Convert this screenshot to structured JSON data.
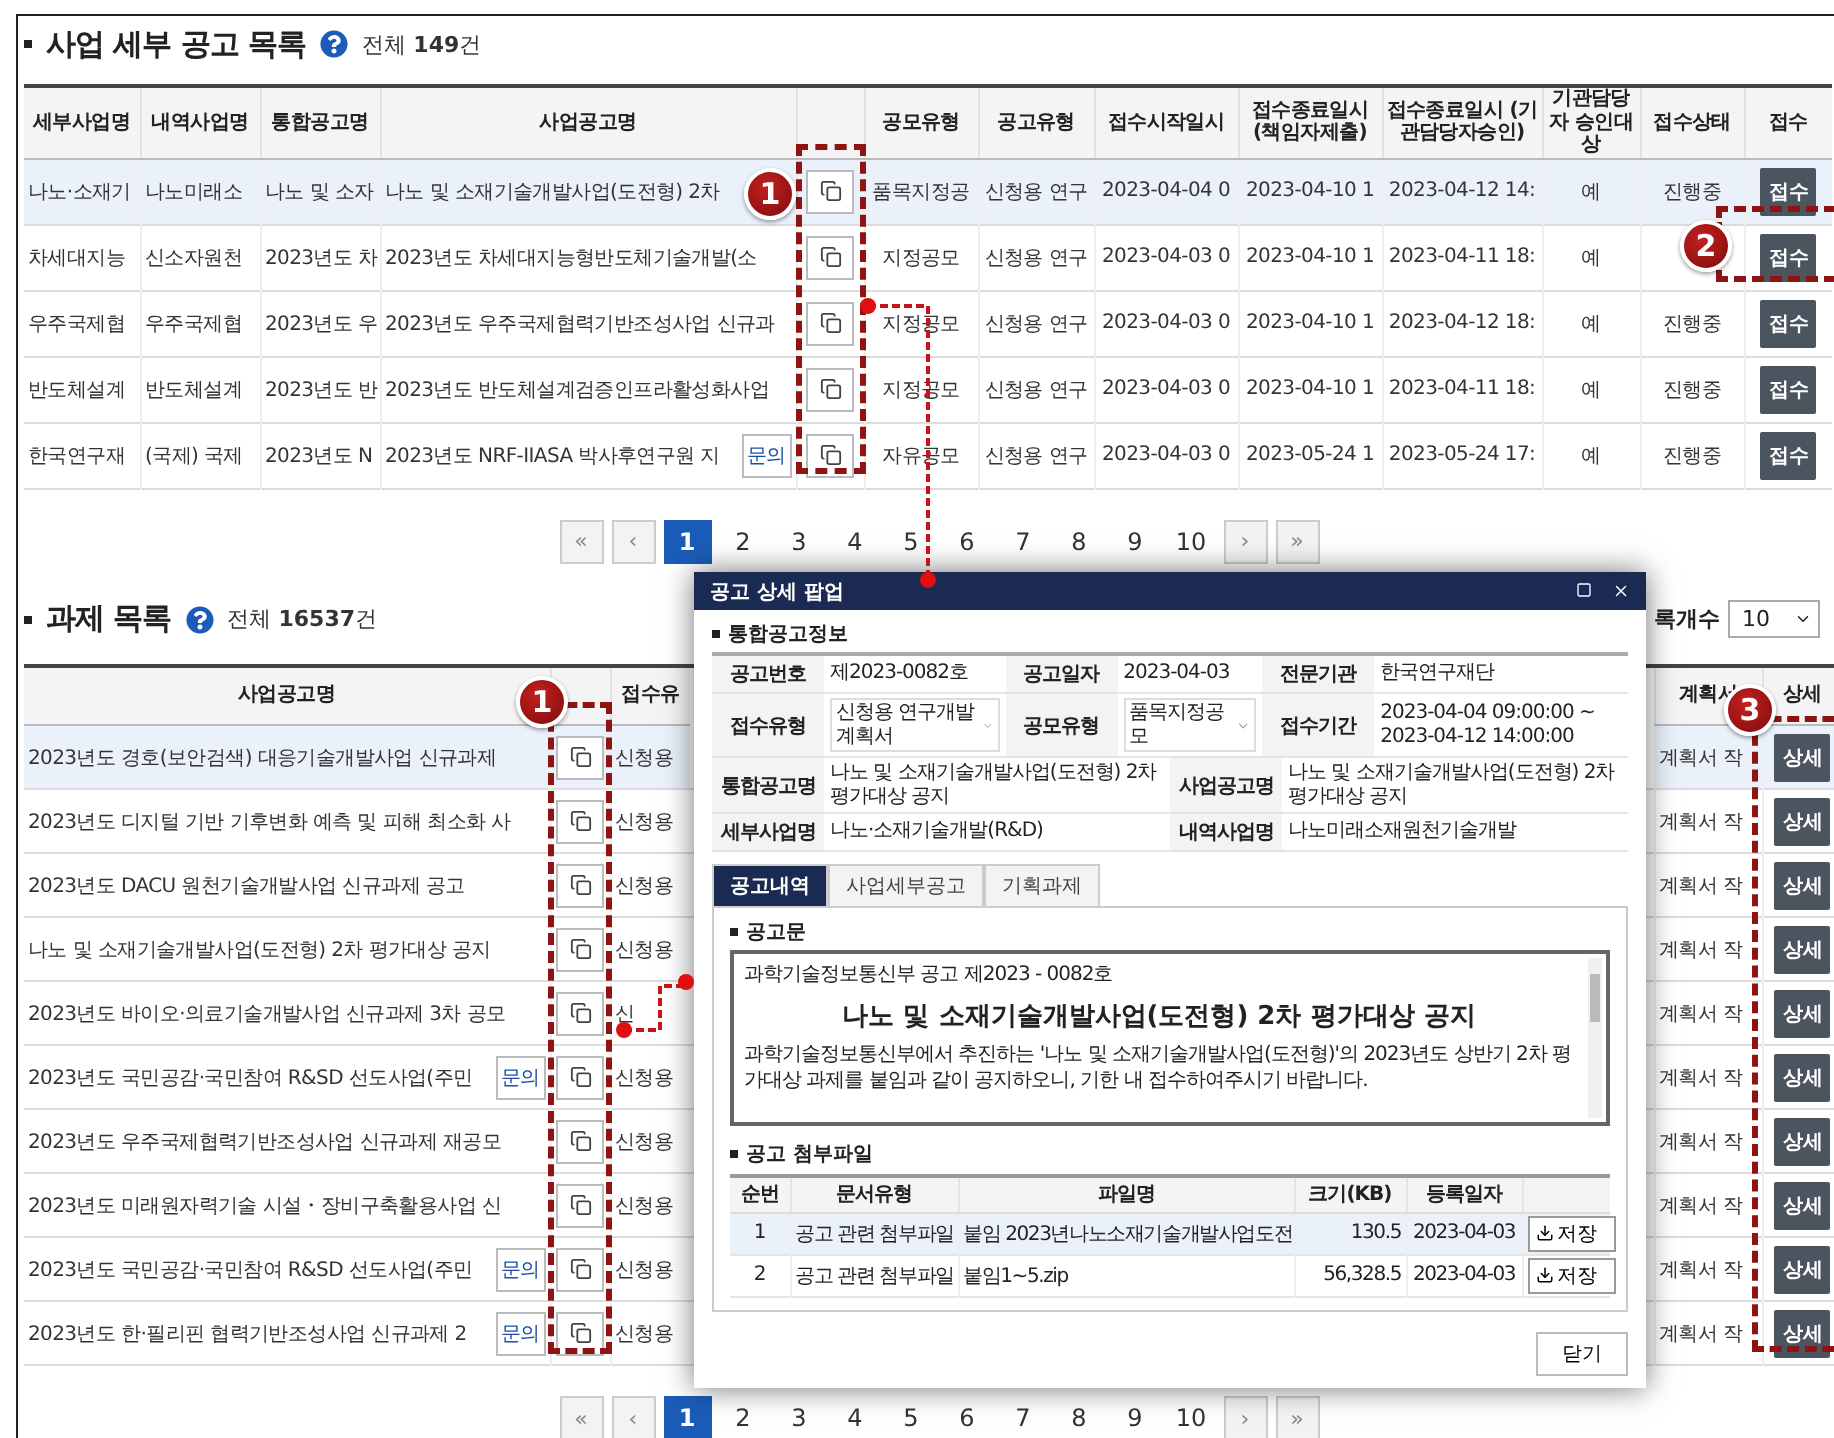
{
  "notices": {
    "title": "사업 세부 공고 목록",
    "total": "전체 **149**건",
    "columns": [
      {
        "kind": "text",
        "label": "세부사업명"
      },
      {
        "kind": "text",
        "label": "내역사업명"
      },
      {
        "kind": "text",
        "label": "통합공고명"
      },
      {
        "kind": "text",
        "label": "사업공고명"
      },
      {
        "kind": "icon"
      },
      {
        "kind": "text",
        "label": "공모유형"
      },
      {
        "kind": "text",
        "label": "공고유형"
      },
      {
        "kind": "text",
        "label": "접수시작일시"
      },
      {
        "kind": "text",
        "label": "접수종료일시 (책임자제출)"
      },
      {
        "kind": "text",
        "label": "접수종료일시 (기관담당자승인)"
      },
      {
        "kind": "text",
        "label": "기관담당자 승인대상"
      },
      {
        "kind": "text",
        "label": "접수상태"
      },
      {
        "kind": "text",
        "label": "접수"
      }
    ],
    "rows": [
      {
        "selected": true,
        "detail": "나노·소재기",
        "sub": "나노미래소",
        "integrated": "나노 및 소자",
        "name": "나노 및 소재기술개발사업(도전형) 2차",
        "contest": "품목지정공",
        "type": "신청용 연구",
        "start": "2023-04-04 0",
        "end_applicant": "2023-04-10 1",
        "end_agency": "2023-04-12 14:",
        "approval": "예",
        "status": "진행중",
        "action": "접수"
      },
      {
        "selected": false,
        "detail": "차세대지능",
        "sub": "신소자원천",
        "integrated": "2023년도 차",
        "name": "2023년도 차세대지능형반도체기술개발(소",
        "contest": "지정공모",
        "type": "신청용 연구",
        "start": "2023-04-03 0",
        "end_applicant": "2023-04-10 1",
        "end_agency": "2023-04-11 18:",
        "approval": "예",
        "action": "접수"
      },
      {
        "selected": false,
        "detail": "우주국제협",
        "sub": "우주국제협",
        "integrated": "2023년도 우",
        "name": "2023년도 우주국제협력기반조성사업 신규과",
        "contest": "지정공모",
        "type": "신청용 연구",
        "start": "2023-04-03 0",
        "end_applicant": "2023-04-10 1",
        "end_agency": "2023-04-12 18:",
        "approval": "예",
        "status": "진행중",
        "action": "접수"
      },
      {
        "selected": false,
        "detail": "반도체설계",
        "sub": "반도체설계",
        "integrated": "2023년도 반",
        "name": "2023년도 반도체설계검증인프라활성화사업",
        "contest": "지정공모",
        "type": "신청용 연구",
        "start": "2023-04-03 0",
        "end_applicant": "2023-04-10 1",
        "end_agency": "2023-04-11 18:",
        "approval": "예",
        "status": "진행중",
        "action": "접수"
      },
      {
        "selected": false,
        "detail": "한국연구재",
        "sub": "(국제) 국제",
        "integrated": "2023년도 N",
        "name": "2023년도 NRF-IIASA 박사후연구원 지",
        "inquiry": "문의",
        "contest": "자유공모",
        "type": "신청용 연구",
        "start": "2023-04-03 0",
        "end_applicant": "2023-05-24 1",
        "end_agency": "2023-05-24 17:",
        "approval": "예",
        "status": "진행중",
        "action": "접수"
      }
    ],
    "pagination": {
      "first": "«",
      "prev": "‹",
      "next": "›",
      "last": "»",
      "pages": [
        {
          "label": "1",
          "selected": true
        },
        {
          "label": "2",
          "selected": false
        },
        {
          "label": "3",
          "selected": false
        },
        {
          "label": "4",
          "selected": false
        },
        {
          "label": "5",
          "selected": false
        },
        {
          "label": "6",
          "selected": false
        },
        {
          "label": "7",
          "selected": false
        },
        {
          "label": "8",
          "selected": false
        },
        {
          "label": "9",
          "selected": false
        },
        {
          "label": "10",
          "selected": false
        }
      ]
    }
  },
  "tasks": {
    "title": "과제 목록",
    "total": "전체 **16537**건",
    "page_size": {
      "label": "록개수",
      "value": "10"
    },
    "columns": [
      {
        "kind": "text",
        "label": "사업공고명"
      },
      {
        "kind": "icon"
      },
      {
        "kind": "text",
        "label": "접수유"
      },
      {
        "kind": "text",
        "label": "계획서"
      },
      {
        "kind": "text",
        "label": "상세"
      }
    ],
    "rows": [
      {
        "selected": true,
        "name": "2023년도 경호(보안검색) 대응기술개발사업 신규과제",
        "type": "신청용",
        "status": "계획서 작",
        "action": "상세"
      },
      {
        "selected": false,
        "name": "2023년도 디지털 기반 기후변화 예측 및 피해 최소화 사",
        "type": "신청용",
        "status": "계획서 작",
        "action": "상세"
      },
      {
        "selected": false,
        "name": "2023년도 DACU 원천기술개발사업 신규과제 공고",
        "type": "신청용",
        "status": "계획서 작",
        "action": "상세"
      },
      {
        "selected": false,
        "name": "나노 및 소재기술개발사업(도전형) 2차 평가대상 공지",
        "type": "신청용",
        "status": "계획서 작",
        "action": "상세"
      },
      {
        "selected": false,
        "name": "2023년도 바이오·의료기술개발사업 신규과제 3차 공모",
        "type": "신",
        "status": "계획서 작",
        "action": "상세"
      },
      {
        "selected": false,
        "name": "2023년도 국민공감·국민참여 R&SD 선도사업(주민",
        "inquiry": "문의",
        "type": "신청용",
        "status": "계획서 작",
        "action": "상세"
      },
      {
        "selected": false,
        "name": "2023년도 우주국제협력기반조성사업 신규과제 재공모",
        "type": "신청용",
        "status": "계획서 작",
        "action": "상세"
      },
      {
        "selected": false,
        "name": "2023년도 미래원자력기술 시설・장비구축활용사업 신",
        "type": "신청용",
        "status": "계획서 작",
        "action": "상세"
      },
      {
        "selected": false,
        "name": "2023년도 국민공감·국민참여 R&SD 선도사업(주민",
        "inquiry": "문의",
        "type": "신청용",
        "status": "계획서 작",
        "action": "상세"
      },
      {
        "selected": false,
        "name": "2023년도 한·필리핀 협력기반조성사업 신규과제 2",
        "inquiry": "문의",
        "type": "신청용",
        "status": "계획서 작",
        "action": "상세"
      }
    ],
    "pagination": {
      "first": "«",
      "prev": "‹",
      "next": "›",
      "last": "»",
      "pages": [
        {
          "label": "1",
          "selected": true
        },
        {
          "label": "2",
          "selected": false
        },
        {
          "label": "3",
          "selected": false
        },
        {
          "label": "4",
          "selected": false
        },
        {
          "label": "5",
          "selected": false
        },
        {
          "label": "6",
          "selected": false
        },
        {
          "label": "7",
          "selected": false
        },
        {
          "label": "8",
          "selected": false
        },
        {
          "label": "9",
          "selected": false
        },
        {
          "label": "10",
          "selected": false
        }
      ]
    }
  },
  "popup": {
    "title": "공고 상세 팝업",
    "section_title": "통합공고정보",
    "info_rows": [
      [
        {
          "label": "공고번호",
          "value": "제2023-0082호",
          "kind": "text"
        },
        {
          "label": "공고일자",
          "value": "2023-04-03",
          "kind": "text"
        },
        {
          "label": "전문기관",
          "value": "한국연구재단",
          "kind": "text"
        }
      ],
      [
        {
          "label": "접수유형",
          "value": "신청용 연구개발계획서",
          "kind": "select"
        },
        {
          "label": "공모유형",
          "value": "품목지정공모",
          "kind": "select"
        },
        {
          "label": "접수기간",
          "value": "2023-04-04 09:00:00 ~ 2023-04-12 14:00:00",
          "kind": "text"
        }
      ],
      [
        {
          "label": "통합공고명",
          "value": "나노 및 소재기술개발사업(도전형) 2차 평가대상 공지",
          "kind": "text"
        },
        {
          "label": "사업공고명",
          "value": "나노 및 소재기술개발사업(도전형) 2차 평가대상 공지",
          "kind": "text"
        }
      ],
      [
        {
          "label": "세부사업명",
          "value": "나노·소재기술개발(R&D)",
          "kind": "text"
        },
        {
          "label": "내역사업명",
          "value": "나노미래소재원천기술개발",
          "kind": "text"
        }
      ]
    ],
    "tabs": [
      {
        "label": "공고내역",
        "selected": true
      },
      {
        "label": "사업세부공고",
        "selected": false
      },
      {
        "label": "기획과제",
        "selected": false
      }
    ],
    "notice": {
      "title": "공고문",
      "number": "과학기술정보통신부 공고 제2023 - 0082호",
      "heading": "나노 및 소재기술개발사업(도전형) 2차 평가대상 공지",
      "body": "과학기술정보통신부에서 추진하는 '나노 및 소재기술개발사업(도전형)'의 2023년도 상반기 2차 평가대상 과제를 붙임과 같이 공지하오니, 기한 내 접수하여주시기 바랍니다."
    },
    "attachments": {
      "title": "공고 첨부파일",
      "columns": [
        "순번",
        "문서유형",
        "파일명",
        "크기(KB)",
        "등록일자"
      ],
      "rows": [
        {
          "selected": true,
          "no": "1",
          "type": "공고 관련 첨부파일",
          "file": "붙임 2023년나노소재기술개발사업도전",
          "size": "130.5",
          "date": "2023-04-03",
          "button": "저장"
        },
        {
          "selected": false,
          "no": "2",
          "type": "공고 관련 첨부파일",
          "file": "붙임1~5.zip",
          "size": "56,328.5",
          "date": "2023-04-03",
          "button": "저장"
        }
      ]
    },
    "close": "닫기"
  },
  "annotations": [
    {
      "number": "1"
    },
    {
      "number": "2"
    },
    {
      "number": "1"
    },
    {
      "number": "3"
    }
  ]
}
